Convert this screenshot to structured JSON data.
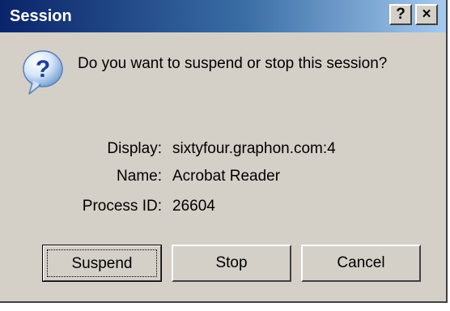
{
  "window": {
    "title": "Session",
    "help_label": "?",
    "close_label": "×"
  },
  "message": {
    "prompt": "Do you want to suspend or stop this session?",
    "icon": "question-icon"
  },
  "details": [
    {
      "label": "Display:",
      "value": "sixtyfour.graphon.com:4"
    },
    {
      "label": "Name:",
      "value": "Acrobat Reader"
    },
    {
      "label": "Process ID:",
      "value": "26604"
    }
  ],
  "buttons": {
    "suspend": "Suspend",
    "stop": "Stop",
    "cancel": "Cancel"
  },
  "colors": {
    "titlebar_start": "#0a246a",
    "titlebar_end": "#a6caf0",
    "face": "#d4d0c8"
  }
}
